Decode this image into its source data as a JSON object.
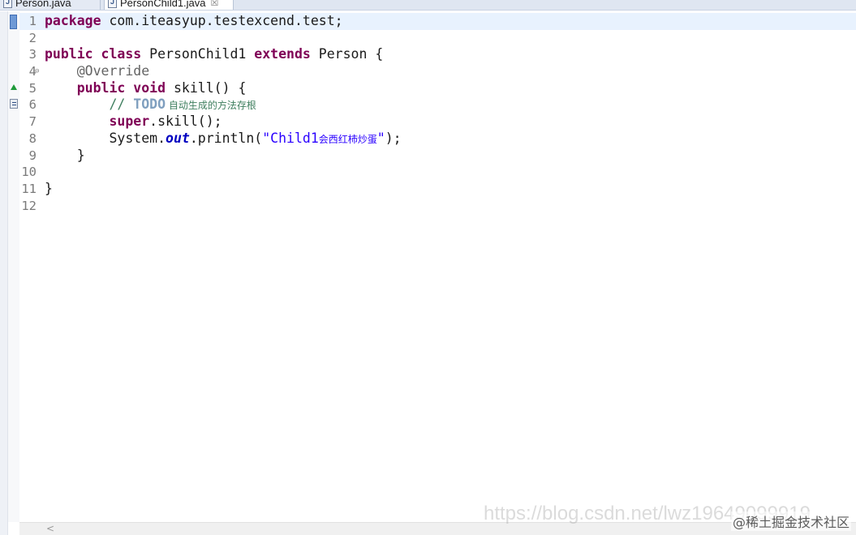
{
  "tabs": [
    {
      "label": "Person.java",
      "active": false
    },
    {
      "label": "PersonChild1.java",
      "active": true,
      "close_glyph": "☒"
    }
  ],
  "editor": {
    "lines": [
      {
        "n": "1",
        "tokens": [
          {
            "t": "package",
            "c": "kw"
          },
          {
            "t": " com.iteasyup.testexcend.test;"
          }
        ]
      },
      {
        "n": "2",
        "tokens": []
      },
      {
        "n": "3",
        "tokens": [
          {
            "t": "public",
            "c": "kw"
          },
          {
            "t": " "
          },
          {
            "t": "class",
            "c": "kw"
          },
          {
            "t": " PersonChild1 "
          },
          {
            "t": "extends",
            "c": "kw"
          },
          {
            "t": " Person {"
          }
        ]
      },
      {
        "n": "4",
        "fold": "⊖",
        "tokens": [
          {
            "t": "    "
          },
          {
            "t": "@Override",
            "c": "ann"
          }
        ]
      },
      {
        "n": "5",
        "tokens": [
          {
            "t": "    "
          },
          {
            "t": "public",
            "c": "kw"
          },
          {
            "t": " "
          },
          {
            "t": "void",
            "c": "kw"
          },
          {
            "t": " skill() {"
          }
        ]
      },
      {
        "n": "6",
        "tokens": [
          {
            "t": "        "
          },
          {
            "t": "// ",
            "c": "cmt"
          },
          {
            "t": "TODO",
            "c": "todo"
          },
          {
            "t": " 自动生成的方法存根",
            "c": "cmt cjk"
          }
        ]
      },
      {
        "n": "7",
        "tokens": [
          {
            "t": "        "
          },
          {
            "t": "super",
            "c": "kw"
          },
          {
            "t": ".skill();"
          }
        ]
      },
      {
        "n": "8",
        "tokens": [
          {
            "t": "        System."
          },
          {
            "t": "out",
            "c": "field"
          },
          {
            "t": ".println("
          },
          {
            "t": "\"Child1",
            "c": "str"
          },
          {
            "t": "会西红柿炒蛋",
            "c": "str cjk"
          },
          {
            "t": "\"",
            "c": "str"
          },
          {
            "t": ");"
          }
        ]
      },
      {
        "n": "9",
        "tokens": [
          {
            "t": "    }"
          }
        ]
      },
      {
        "n": "10",
        "tokens": []
      },
      {
        "n": "11",
        "tokens": [
          {
            "t": "}"
          }
        ]
      },
      {
        "n": "12",
        "tokens": []
      }
    ]
  },
  "scrollbar": {
    "left_arrow": "<"
  },
  "watermark": {
    "url_text": "https://blog.csdn.net/lwz19649099919",
    "brand": "@稀土掘金技术社区"
  }
}
